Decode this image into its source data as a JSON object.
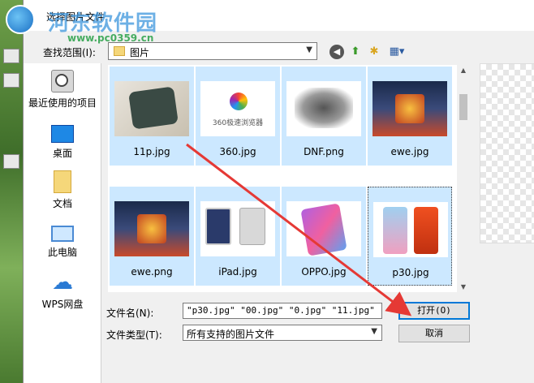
{
  "dialog": {
    "title": "选择图片文件",
    "watermark_title": "河东软件园",
    "watermark_url": "www.pc0359.cn"
  },
  "toolbar": {
    "lookin_label": "查找范围(I):",
    "lookin_value": "图片",
    "back_icon": "back-arrow-icon",
    "up_icon": "up-folder-icon",
    "new_folder_icon": "new-folder-icon",
    "view_icon": "view-menu-icon"
  },
  "places": [
    {
      "label": "最近使用的项目",
      "icon": "recent-items-icon"
    },
    {
      "label": "桌面",
      "icon": "desktop-icon"
    },
    {
      "label": "文档",
      "icon": "documents-icon"
    },
    {
      "label": "此电脑",
      "icon": "this-pc-icon"
    },
    {
      "label": "WPS网盘",
      "icon": "wps-cloud-icon"
    }
  ],
  "files": [
    {
      "name": "11p.jpg",
      "selected": true
    },
    {
      "name": "360.jpg",
      "selected": true
    },
    {
      "name": "DNF.png",
      "selected": true
    },
    {
      "name": "ewe.jpg",
      "selected": true
    },
    {
      "name": "ewe.png",
      "selected": true
    },
    {
      "name": "iPad.jpg",
      "selected": true
    },
    {
      "name": "OPPO.jpg",
      "selected": true
    },
    {
      "name": "p30.jpg",
      "selected": true,
      "focused": true
    }
  ],
  "thumb_text_360": "360极速浏览器",
  "filename": {
    "label": "文件名(N):",
    "value": "\"p30.jpg\" \"00.jpg\" \"0.jpg\" \"11.jpg\" \""
  },
  "filetype": {
    "label": "文件类型(T):",
    "value": "所有支持的图片文件"
  },
  "buttons": {
    "open": "打开(O)",
    "cancel": "取消"
  },
  "colors": {
    "selection": "#cce8ff",
    "annotation_arrow": "#e53935",
    "primary_border": "#0078d7"
  }
}
